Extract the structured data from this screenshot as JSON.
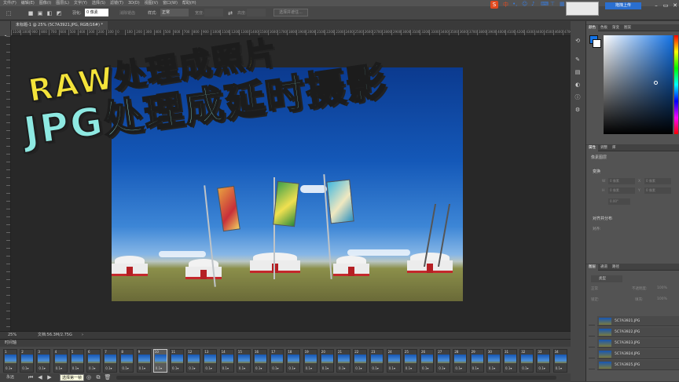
{
  "menubar": {
    "items": [
      "文件(F)",
      "编辑(E)",
      "图像(I)",
      "图层(L)",
      "文字(Y)",
      "选择(S)",
      "滤镜(T)",
      "3D(D)",
      "视图(V)",
      "窗口(W)",
      "帮助(H)"
    ]
  },
  "options": {
    "feather_label": "羽化:",
    "feather_value": "0 像素",
    "antialias": "消除锯齿",
    "style_label": "样式:",
    "style_value": "正常",
    "width_label": "宽度:",
    "height_label": "高度:",
    "select_mask": "选择并遮住..."
  },
  "document": {
    "tab_title": "未标题-1 @ 25% (5C7A3921.JPG, RGB/16#) *",
    "zoom": "25%",
    "doc_size": "文档:56.3M/2.75G"
  },
  "ruler": {
    "h_ticks": [
      "1100",
      "1000",
      "900",
      "800",
      "700",
      "600",
      "500",
      "400",
      "300",
      "200",
      "100",
      "0",
      "100",
      "200",
      "300",
      "400",
      "500",
      "600",
      "700",
      "800",
      "900",
      "1000",
      "1100",
      "1200",
      "1300",
      "1400",
      "1500",
      "1600",
      "1700",
      "1800",
      "1900",
      "2000",
      "2100",
      "2200",
      "2300",
      "2400",
      "2500",
      "2600",
      "2700",
      "2800",
      "2900",
      "3000",
      "3100",
      "3200",
      "3300",
      "3400",
      "3500",
      "3600",
      "3700",
      "3800",
      "3900",
      "4000",
      "4100",
      "4200",
      "4300",
      "4400",
      "4500",
      "4600",
      "4700",
      "4800"
    ]
  },
  "overlay": {
    "line1": "RAW处理成照片",
    "line2": "JPG处理成延时摄影"
  },
  "timeline": {
    "title": "时间轴",
    "frames": [
      "1",
      "2",
      "3",
      "4",
      "5",
      "6",
      "7",
      "8",
      "9",
      "10",
      "11",
      "12",
      "13",
      "14",
      "15",
      "16",
      "17",
      "18",
      "19",
      "20",
      "21",
      "22",
      "23",
      "24",
      "25",
      "26",
      "27",
      "28",
      "29",
      "30",
      "31",
      "32",
      "33",
      "34"
    ],
    "duration": "0.1",
    "selected_frame": 10,
    "loop_label": "永远",
    "tooltip": "选择第一帧"
  },
  "panels": {
    "color_tabs": [
      "颜色",
      "色板",
      "渐变",
      "图案"
    ],
    "props_tabs": [
      "属性",
      "调整",
      "库"
    ],
    "props_type": "像素图层",
    "transform_label": "变换",
    "w_label": "W",
    "h_label": "H",
    "x_label": "X",
    "y_label": "Y",
    "px_unit": "0 像素",
    "angle": "0.00°",
    "align_label": "对齐并分布",
    "align_sub": "对齐:",
    "layers_tabs": [
      "图层",
      "通道",
      "路径"
    ],
    "layer_kind": "类型",
    "blend_mode": "正常",
    "opacity_label": "不透明度:",
    "opacity_value": "100%",
    "lock_label": "锁定:",
    "fill_label": "填充:",
    "fill_value": "100%",
    "layers": [
      "5C7A3921.JPG",
      "5C7A3922.JPG",
      "5C7A3923.JPG",
      "5C7A3924.JPG",
      "5C7A3925.JPG"
    ]
  },
  "topright": {
    "sogou": "S",
    "lang": "中",
    "upload": "拖拽上传"
  },
  "colors": {
    "accent": "#1473e6",
    "title_yellow": "#f4e33a",
    "title_cyan": "#8ee9e2",
    "bg": "#282828"
  }
}
